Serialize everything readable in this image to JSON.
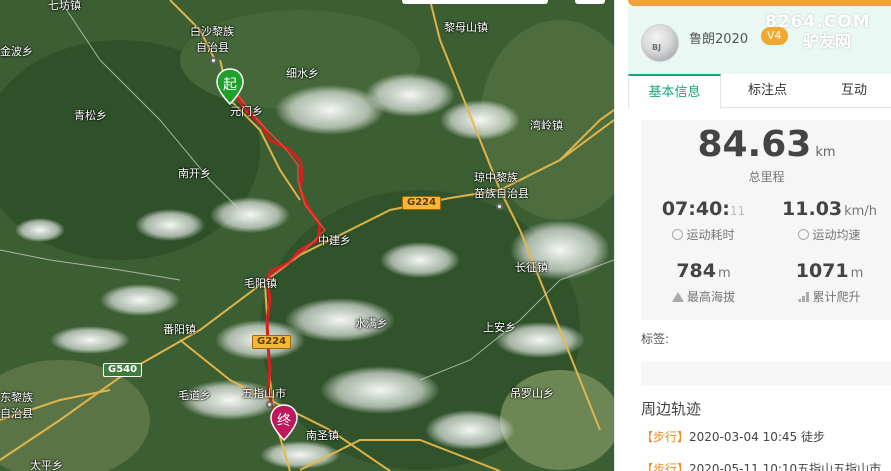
{
  "map": {
    "start_marker": "起",
    "end_marker": "终",
    "road_labels": [
      "G224",
      "G224",
      "G540"
    ],
    "places": [
      "七坊镇",
      "白沙黎族",
      "自治县",
      "金波乡",
      "细水乡",
      "元门乡",
      "青松乡",
      "黎母山镇",
      "湾岭镇",
      "琼中黎族",
      "苗族自治县",
      "南开乡",
      "中建乡",
      "毛阳镇",
      "长征镇",
      "番阳镇",
      "水满乡",
      "上安乡",
      "五指山市",
      "毛道乡",
      "吊罗山乡",
      "南圣镇",
      "东黎族",
      "自治县",
      "太平乡"
    ]
  },
  "panel": {
    "user": {
      "name": "鲁朗2020",
      "badge": "V4",
      "watermark_1": "8264.COM",
      "watermark_2": "驴友网"
    },
    "tabs": [
      "基本信息",
      "标注点",
      "互动"
    ],
    "stats": {
      "distance": "84.63",
      "distance_unit": "km",
      "distance_label": "总里程",
      "moving_time": "07:40:",
      "moving_time_sec": "11",
      "moving_time_label": "运动耗时",
      "avg_speed": "11.03",
      "avg_speed_unit": "km/h",
      "avg_speed_label": "运动均速",
      "max_alt": "784",
      "max_alt_unit": "m",
      "max_alt_label": "最高海拔",
      "climb": "1071",
      "climb_unit": "m",
      "climb_label": "累计爬升"
    },
    "tags_label": "标签:",
    "nearby_title": "周边轨迹",
    "tracks": [
      {
        "type": "【步行】",
        "text": "2020-03-04 10:45 徒步"
      },
      {
        "type": "【步行】",
        "text": "2020-05-11 10:10五指山五指山市"
      }
    ]
  },
  "colors": {
    "accent": "#19a37a",
    "route": "#d42020",
    "start": "#1fa02a",
    "end": "#c0185c",
    "track_type": "#f08a1c"
  }
}
